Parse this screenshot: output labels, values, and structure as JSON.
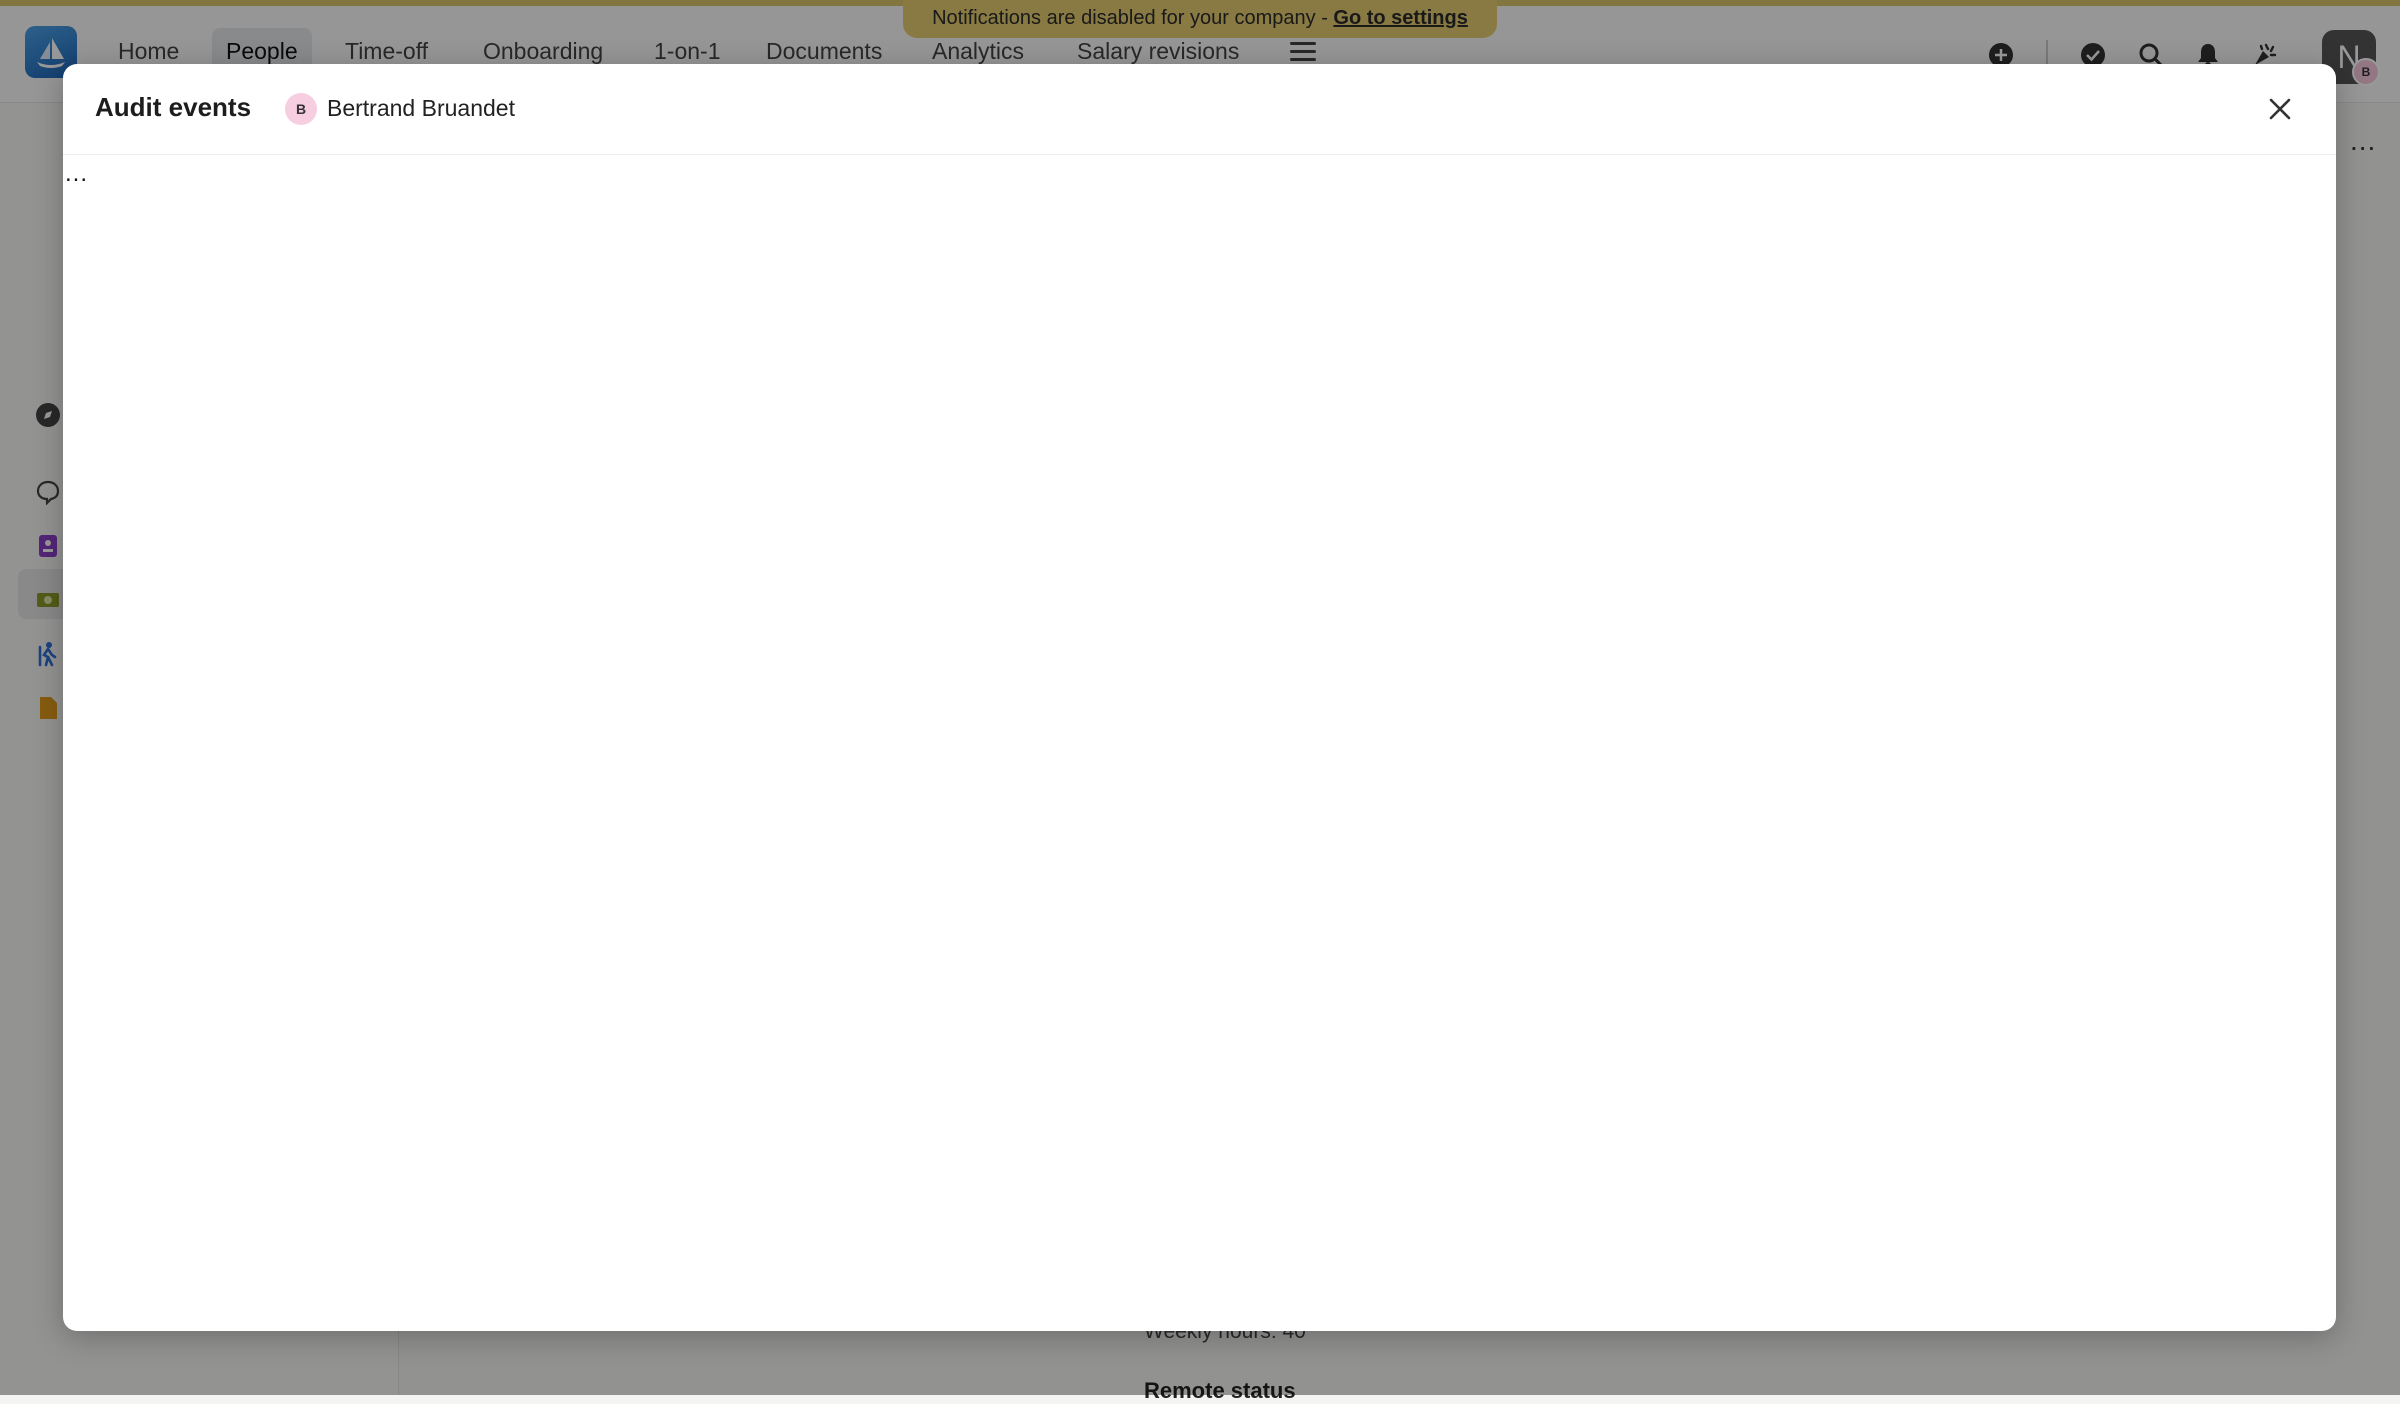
{
  "nav": {
    "items": [
      {
        "label": "Home"
      },
      {
        "label": "People",
        "active": true
      },
      {
        "label": "Time-off"
      },
      {
        "label": "Onboarding"
      },
      {
        "label": "1-on-1"
      },
      {
        "label": "Documents"
      },
      {
        "label": "Analytics"
      },
      {
        "label": "Salary revisions"
      }
    ],
    "menu_icon": "hamburger-menu-icon",
    "user_avatar_letter": "N",
    "user_badge_letter": "B"
  },
  "notice": {
    "text": "Notifications are disabled for your company - ",
    "link": "Go to settings"
  },
  "top_icons": [
    "plus-circle-icon",
    "check-circle-icon",
    "search-icon",
    "bell-icon",
    "sparkle-icon"
  ],
  "sidebar_icons": [
    "compass-icon",
    "chat-icon",
    "badge-icon",
    "money-icon",
    "walking-icon",
    "document-icon"
  ],
  "background": {
    "more": "...",
    "weekly_hours": "Weekly hours: 40",
    "remote_status": "Remote status"
  },
  "modal": {
    "title": "Audit events",
    "person_initial": "B",
    "person_name": "Bertrand Bruandet",
    "loading": "..."
  },
  "colors": {
    "notice_bg": "#e3cc6f",
    "person_avatar_bg": "#f7cde0",
    "logo": "#1f66b8"
  }
}
